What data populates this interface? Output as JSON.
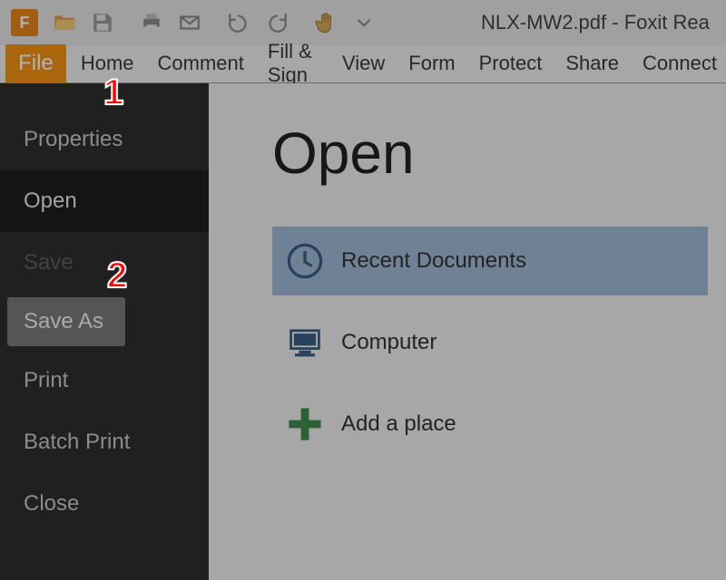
{
  "window": {
    "title": "NLX-MW2.pdf - Foxit Rea"
  },
  "ribbon": {
    "file_label": "File",
    "tabs": [
      "Home",
      "Comment",
      "Fill & Sign",
      "View",
      "Form",
      "Protect",
      "Share",
      "Connect"
    ]
  },
  "sidebar": {
    "items": [
      {
        "label": "Properties",
        "state": "normal"
      },
      {
        "label": "Open",
        "state": "selected"
      },
      {
        "label": "Save",
        "state": "disabled"
      },
      {
        "label": "Save As",
        "state": "box"
      },
      {
        "label": "Print",
        "state": "normal"
      },
      {
        "label": "Batch Print",
        "state": "normal"
      },
      {
        "label": "Close",
        "state": "normal"
      }
    ]
  },
  "main": {
    "heading": "Open",
    "places": [
      {
        "label": "Recent Documents",
        "icon": "clock-icon",
        "selected": true
      },
      {
        "label": "Computer",
        "icon": "computer-icon",
        "selected": false
      },
      {
        "label": "Add a place",
        "icon": "plus-icon",
        "selected": false
      }
    ]
  },
  "annotations": {
    "n1": "1",
    "n2": "2"
  }
}
